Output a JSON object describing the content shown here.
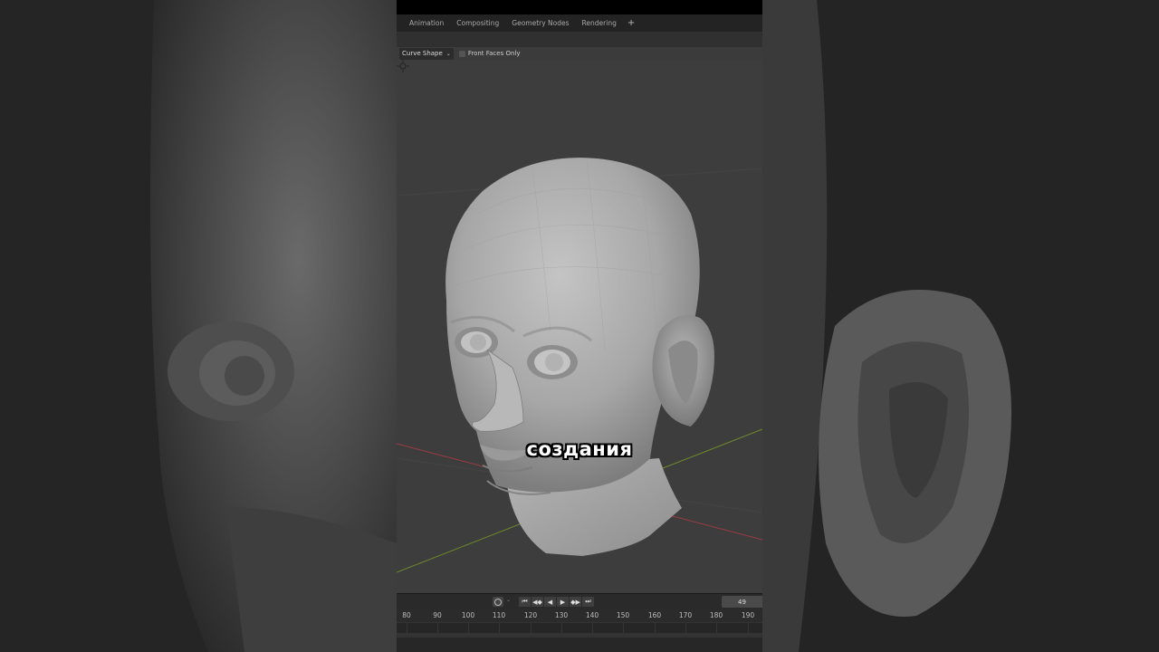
{
  "workspace_tabs": [
    "Animation",
    "Compositing",
    "Geometry Nodes",
    "Rendering"
  ],
  "add_tab_label": "+",
  "header": {
    "falloff_dropdown": "Curve Shape",
    "front_faces_label": "Front Faces Only",
    "front_faces_checked": false
  },
  "caption": "создания",
  "timeline": {
    "current_frame": "49",
    "transport_icons": [
      "jump-start-icon",
      "prev-keyframe-icon",
      "play-reverse-icon",
      "play-icon",
      "next-keyframe-icon",
      "jump-end-icon"
    ],
    "ruler_ticks": [
      "80",
      "90",
      "100",
      "110",
      "120",
      "130",
      "140",
      "150",
      "160",
      "170",
      "180",
      "190"
    ]
  },
  "colors": {
    "viewport_bg": "#3d3d3d",
    "x_axis": "#9a3a44",
    "y_axis": "#6f8a2a",
    "mesh": "#a9a9a9"
  }
}
